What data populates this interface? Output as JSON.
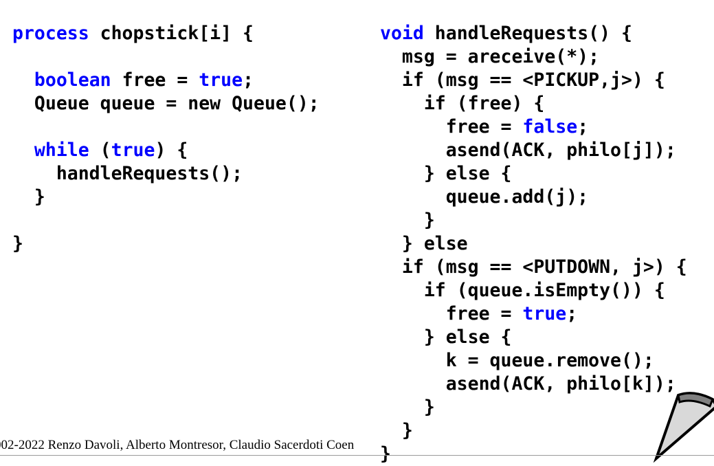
{
  "slide": {
    "background_color": "#FFFFFF",
    "text_color": "#000000",
    "keyword_color": "#0000FF",
    "code_font_style": "monospace-bold"
  },
  "left_column": {
    "name": "chopstick-process-code",
    "lines": [
      [
        {
          "t": "process",
          "k": true
        },
        {
          "t": " chopstick[i] {",
          "k": false
        }
      ],
      [
        {
          "t": "",
          "k": false
        }
      ],
      [
        {
          "t": "  ",
          "k": false
        },
        {
          "t": "boolean",
          "k": true
        },
        {
          "t": " free = ",
          "k": false
        },
        {
          "t": "true",
          "k": true
        },
        {
          "t": ";",
          "k": false
        }
      ],
      [
        {
          "t": "  Queue queue = new Queue();",
          "k": false
        }
      ],
      [
        {
          "t": "",
          "k": false
        }
      ],
      [
        {
          "t": "  ",
          "k": false
        },
        {
          "t": "while",
          "k": true
        },
        {
          "t": " (",
          "k": false
        },
        {
          "t": "true",
          "k": true
        },
        {
          "t": ") {",
          "k": false
        }
      ],
      [
        {
          "t": "    handleRequests();",
          "k": false
        }
      ],
      [
        {
          "t": "  }",
          "k": false
        }
      ],
      [
        {
          "t": "",
          "k": false
        }
      ],
      [
        {
          "t": "}",
          "k": false
        }
      ]
    ],
    "plain_text": "process chopstick[i] {\n\n  boolean free = true;\n  Queue queue = new Queue();\n\n  while (true) {\n    handleRequests();\n  }\n\n}"
  },
  "right_column": {
    "name": "handle-requests-code",
    "lines": [
      [
        {
          "t": "void",
          "k": true
        },
        {
          "t": " handleRequests() {",
          "k": false
        }
      ],
      [
        {
          "t": "  msg = areceive(*);",
          "k": false
        }
      ],
      [
        {
          "t": "  if (msg == <PICKUP,j>) {",
          "k": false
        }
      ],
      [
        {
          "t": "    if (free) {",
          "k": false
        }
      ],
      [
        {
          "t": "      free = ",
          "k": false
        },
        {
          "t": "false",
          "k": true
        },
        {
          "t": ";",
          "k": false
        }
      ],
      [
        {
          "t": "      asend(ACK, philo[j]);",
          "k": false
        }
      ],
      [
        {
          "t": "    } else {",
          "k": false
        }
      ],
      [
        {
          "t": "      queue.add(j);",
          "k": false
        }
      ],
      [
        {
          "t": "    }",
          "k": false
        }
      ],
      [
        {
          "t": "  } else",
          "k": false
        }
      ],
      [
        {
          "t": "  if (msg == <PUTDOWN, j>) {",
          "k": false
        }
      ],
      [
        {
          "t": "    if (queue.isEmpty()) {",
          "k": false
        }
      ],
      [
        {
          "t": "      free = ",
          "k": false
        },
        {
          "t": "true",
          "k": true
        },
        {
          "t": ";",
          "k": false
        }
      ],
      [
        {
          "t": "    } else {",
          "k": false
        }
      ],
      [
        {
          "t": "      k = queue.remove();",
          "k": false
        }
      ],
      [
        {
          "t": "      asend(ACK, philo[k]);",
          "k": false
        }
      ],
      [
        {
          "t": "    }",
          "k": false
        }
      ],
      [
        {
          "t": "  }",
          "k": false
        }
      ],
      [
        {
          "t": "}",
          "k": false
        }
      ]
    ],
    "plain_text": "void handleRequests() {\n  msg = areceive(*);\n  if (msg == <PICKUP,j>) {\n    if (free) {\n      free = false;\n      asend(ACK, philo[j]);\n    } else {\n      queue.add(j);\n    }\n  } else\n  if (msg == <PUTDOWN, j>) {\n    if (queue.isEmpty()) {\n      free = true;\n    } else {\n      k = queue.remove();\n      asend(ACK, philo[k]);\n    }\n  }\n}"
  },
  "footer": {
    "copyright": "002-2022 Renzo Davoli, Alberto Montresor, Claudio Sacerdoti Coen",
    "rule_color": "#9A9A9A"
  },
  "decoration": {
    "page_curl": {
      "name": "page-curl-icon",
      "fill": "#D9D9D9",
      "stroke": "#000000",
      "cap_fill": "#808080"
    }
  }
}
